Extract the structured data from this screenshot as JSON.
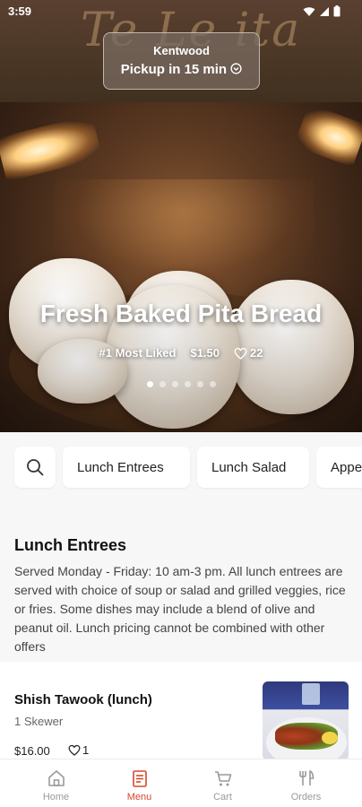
{
  "status_bar": {
    "time": "3:59"
  },
  "hero": {
    "pickup": {
      "location": "Kentwood",
      "time_text": "Pickup in 15 min"
    },
    "featured": {
      "title": "Fresh Baked Pita Bread",
      "rank": "#1 Most Liked",
      "price": "$1.50",
      "likes": "22"
    },
    "carousel": {
      "count": 6,
      "active_index": 0
    }
  },
  "categories": {
    "search_icon": "search-icon",
    "chips": [
      "Lunch Entrees",
      "Lunch Salad",
      "Appe"
    ]
  },
  "section": {
    "title": "Lunch Entrees",
    "description": "Served Monday - Friday: 10 am-3 pm. All lunch entrees are served with choice of soup or salad and grilled veggies, rice or fries. Some dishes may include a blend of olive and peanut oil. Lunch pricing cannot be combined with other offers"
  },
  "items": [
    {
      "name": "Shish Tawook (lunch)",
      "description": "1 Skewer",
      "price": "$16.00",
      "likes": "1"
    }
  ],
  "nav": {
    "items": [
      {
        "label": "Home",
        "icon": "home-icon"
      },
      {
        "label": "Menu",
        "icon": "menu-icon"
      },
      {
        "label": "Cart",
        "icon": "cart-icon"
      },
      {
        "label": "Orders",
        "icon": "orders-icon"
      }
    ],
    "active": "Menu"
  },
  "colors": {
    "accent": "#d9462b",
    "inactive": "#9a9a9a"
  }
}
